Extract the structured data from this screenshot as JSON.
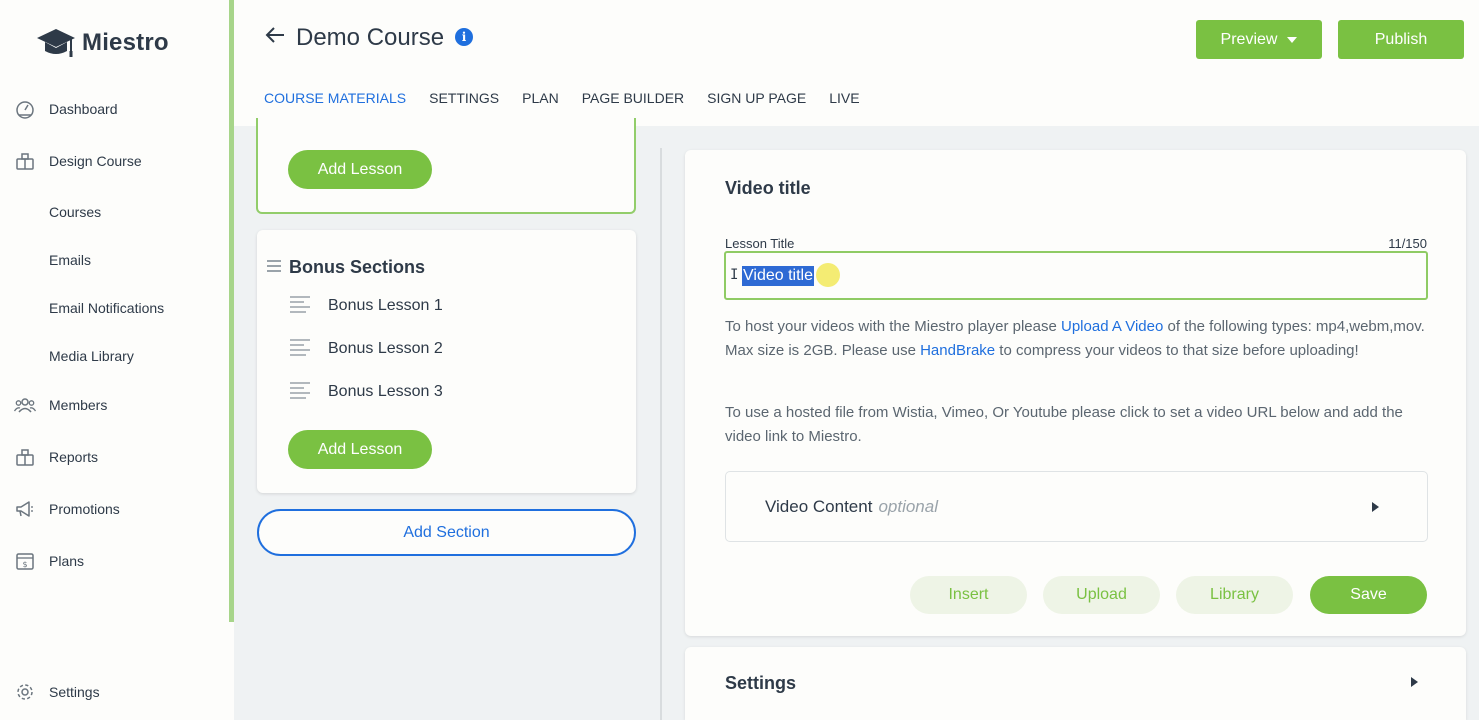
{
  "app": {
    "name": "Miestro"
  },
  "sidebar": {
    "items": [
      {
        "label": "Dashboard",
        "icon": "dashboard-gauge-icon"
      },
      {
        "label": "Design Course",
        "icon": "design-course-icon"
      },
      {
        "label": "Members",
        "icon": "members-icon"
      },
      {
        "label": "Reports",
        "icon": "reports-icon"
      },
      {
        "label": "Promotions",
        "icon": "megaphone-icon"
      },
      {
        "label": "Plans",
        "icon": "plans-dollar-icon"
      }
    ],
    "sub_items": [
      "Courses",
      "Emails",
      "Email Notifications",
      "Media Library"
    ],
    "settings_label": "Settings"
  },
  "header": {
    "title": "Demo Course",
    "info_icon_glyph": "i",
    "preview_label": "Preview",
    "publish_label": "Publish",
    "tabs": [
      {
        "label": "COURSE MATERIALS",
        "active": true
      },
      {
        "label": "SETTINGS",
        "active": false
      },
      {
        "label": "PLAN",
        "active": false
      },
      {
        "label": "PAGE BUILDER",
        "active": false
      },
      {
        "label": "SIGN UP PAGE",
        "active": false
      },
      {
        "label": "LIVE",
        "active": false
      }
    ]
  },
  "outline": {
    "add_lesson_label": "Add Lesson",
    "section_title": "Bonus Sections",
    "lessons": [
      "Bonus Lesson 1",
      "Bonus Lesson 2",
      "Bonus Lesson 3"
    ],
    "add_section_label": "Add Section"
  },
  "editor": {
    "heading": "Video title",
    "field_label": "Lesson Title",
    "char_count": "11/150",
    "title_value": "Video title",
    "help1_a": "To host your videos with the Miestro player please ",
    "help1_link1": "Upload A Video",
    "help1_b": " of the following types: mp4,webm,mov. Max size is 2GB. Please use ",
    "help1_link2": "HandBrake",
    "help1_c": " to compress your videos to that size before uploading!",
    "help2": "To use a hosted file from Wistia, Vimeo, Or Youtube please click to set a video URL below and add the video link to Miestro.",
    "video_content_label": "Video Content",
    "video_content_optional": "optional",
    "insert_label": "Insert",
    "upload_label": "Upload",
    "library_label": "Library",
    "save_label": "Save"
  },
  "settings_panel": {
    "label": "Settings"
  },
  "colors": {
    "accent_green": "#7ac142",
    "link_blue": "#1f6fde",
    "text_dark": "#2e3a48",
    "selection_blue": "#2e6ad4"
  }
}
